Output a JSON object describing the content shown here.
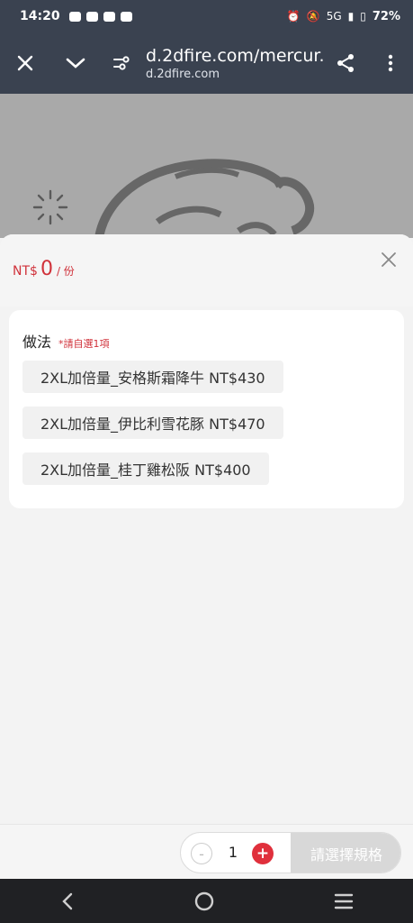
{
  "status_bar": {
    "time": "14:20",
    "battery": "72%",
    "network": "5G"
  },
  "browser": {
    "url_title": "d.2dfire.com/mercur...",
    "url_domain": "d.2dfire.com"
  },
  "sheet": {
    "price_currency": "NT$",
    "price_amount": "0",
    "price_unit": "/ 份",
    "section_title": "做法",
    "required_hint": "*請自選1項",
    "options": [
      "2XL加倍量_安格斯霜降牛 NT$430",
      "2XL加倍量_伊比利雪花豚 NT$470",
      "2XL加倍量_桂丁雞松阪 NT$400"
    ]
  },
  "bottom_bar": {
    "minus": "-",
    "quantity": "1",
    "plus": "+",
    "confirm_label": "請選擇規格"
  },
  "colors": {
    "accent": "#e0303c",
    "price": "#d0313a",
    "toolbar": "#3a4250"
  }
}
